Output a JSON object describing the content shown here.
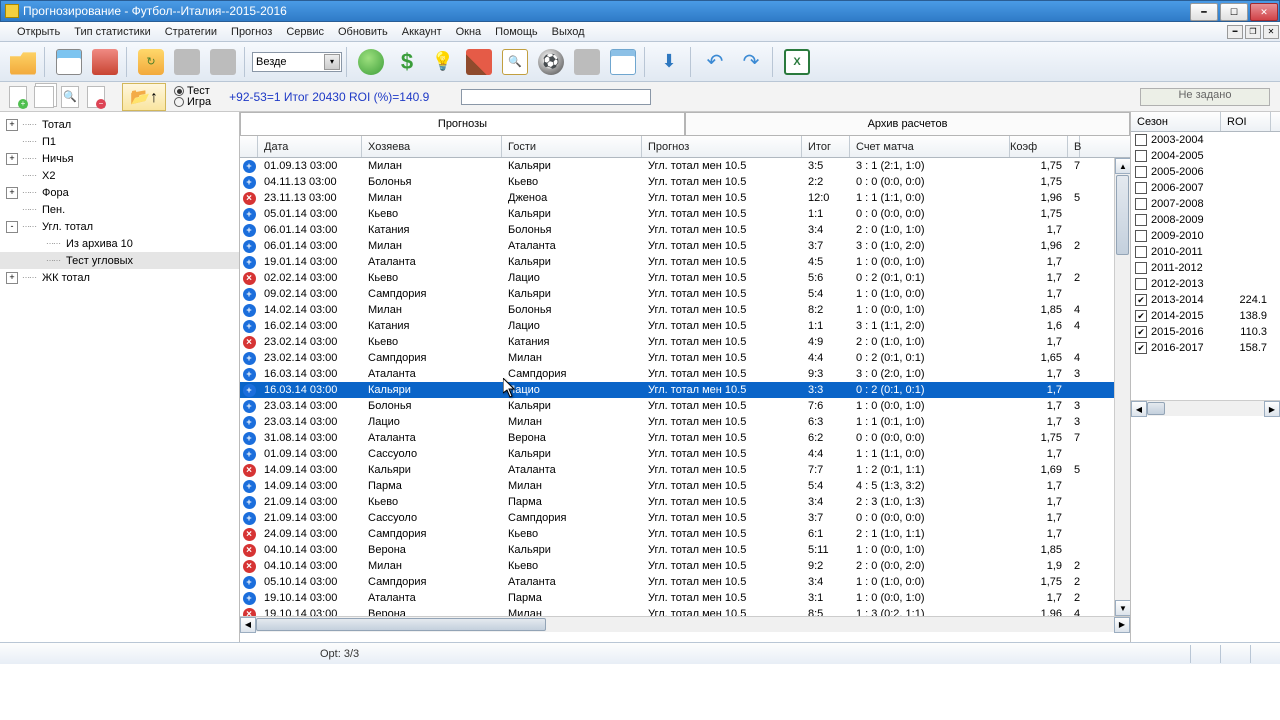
{
  "title": "Прогнозирование - Футбол--Италия--2015-2016",
  "menu": [
    "Открыть",
    "Тип статистики",
    "Стратегии",
    "Прогноз",
    "Сервис",
    "Обновить",
    "Аккаунт",
    "Окна",
    "Помощь",
    "Выход"
  ],
  "combo": "Везде",
  "radio": {
    "test": "Тест",
    "game": "Игра"
  },
  "summary": "+92-53=1 Итог 20430 ROI (%)=140.9",
  "unassigned": "Не задано",
  "tree": [
    {
      "label": "Тотал",
      "toggle": "+"
    },
    {
      "label": "П1",
      "none": true
    },
    {
      "label": "Ничья",
      "toggle": "+"
    },
    {
      "label": "X2",
      "none": true
    },
    {
      "label": "Фора",
      "toggle": "+"
    },
    {
      "label": "Пен.",
      "none": true
    },
    {
      "label": "Угл. тотал",
      "toggle": "-",
      "children": [
        {
          "label": "Из архива 10"
        },
        {
          "label": "Тест угловых",
          "selected": true
        }
      ]
    },
    {
      "label": "ЖК тотал",
      "toggle": "+"
    }
  ],
  "tabs": {
    "forecasts": "Прогнозы",
    "archive": "Архив расчетов"
  },
  "columns": [
    "Дата",
    "Хозяева",
    "Гости",
    "Прогноз",
    "Итог",
    "Счет матча",
    "Коэф",
    "В"
  ],
  "rows": [
    {
      "p": 1,
      "d": "01.09.13 03:00",
      "h": "Милан",
      "a": "Кальяри",
      "pr": "Угл. тотал мен 10.5",
      "i": "3:5",
      "s": "3 : 1 (2:1, 1:0)",
      "c": "1,75",
      "l": "7"
    },
    {
      "p": 1,
      "d": "04.11.13 03:00",
      "h": "Болонья",
      "a": "Кьево",
      "pr": "Угл. тотал мен 10.5",
      "i": "2:2",
      "s": "0 : 0 (0:0, 0:0)",
      "c": "1,75",
      "l": ""
    },
    {
      "p": 0,
      "d": "23.11.13 03:00",
      "h": "Милан",
      "a": "Дженоа",
      "pr": "Угл. тотал мен 10.5",
      "i": "12:0",
      "s": "1 : 1 (1:1, 0:0)",
      "c": "1,96",
      "l": "5"
    },
    {
      "p": 1,
      "d": "05.01.14 03:00",
      "h": "Кьево",
      "a": "Кальяри",
      "pr": "Угл. тотал мен 10.5",
      "i": "1:1",
      "s": "0 : 0 (0:0, 0:0)",
      "c": "1,75",
      "l": ""
    },
    {
      "p": 1,
      "d": "06.01.14 03:00",
      "h": "Катания",
      "a": "Болонья",
      "pr": "Угл. тотал мен 10.5",
      "i": "3:4",
      "s": "2 : 0 (1:0, 1:0)",
      "c": "1,7",
      "l": ""
    },
    {
      "p": 1,
      "d": "06.01.14 03:00",
      "h": "Милан",
      "a": "Аталанта",
      "pr": "Угл. тотал мен 10.5",
      "i": "3:7",
      "s": "3 : 0 (1:0, 2:0)",
      "c": "1,96",
      "l": "2"
    },
    {
      "p": 1,
      "d": "19.01.14 03:00",
      "h": "Аталанта",
      "a": "Кальяри",
      "pr": "Угл. тотал мен 10.5",
      "i": "4:5",
      "s": "1 : 0 (0:0, 1:0)",
      "c": "1,7",
      "l": ""
    },
    {
      "p": 0,
      "d": "02.02.14 03:00",
      "h": "Кьево",
      "a": "Лацио",
      "pr": "Угл. тотал мен 10.5",
      "i": "5:6",
      "s": "0 : 2 (0:1, 0:1)",
      "c": "1,7",
      "l": "2"
    },
    {
      "p": 1,
      "d": "09.02.14 03:00",
      "h": "Сампдория",
      "a": "Кальяри",
      "pr": "Угл. тотал мен 10.5",
      "i": "5:4",
      "s": "1 : 0 (1:0, 0:0)",
      "c": "1,7",
      "l": ""
    },
    {
      "p": 1,
      "d": "14.02.14 03:00",
      "h": "Милан",
      "a": "Болонья",
      "pr": "Угл. тотал мен 10.5",
      "i": "8:2",
      "s": "1 : 0 (0:0, 1:0)",
      "c": "1,85",
      "l": "4"
    },
    {
      "p": 1,
      "d": "16.02.14 03:00",
      "h": "Катания",
      "a": "Лацио",
      "pr": "Угл. тотал мен 10.5",
      "i": "1:1",
      "s": "3 : 1 (1:1, 2:0)",
      "c": "1,6",
      "l": "4"
    },
    {
      "p": 0,
      "d": "23.02.14 03:00",
      "h": "Кьево",
      "a": "Катания",
      "pr": "Угл. тотал мен 10.5",
      "i": "4:9",
      "s": "2 : 0 (1:0, 1:0)",
      "c": "1,7",
      "l": ""
    },
    {
      "p": 1,
      "d": "23.02.14 03:00",
      "h": "Сампдория",
      "a": "Милан",
      "pr": "Угл. тотал мен 10.5",
      "i": "4:4",
      "s": "0 : 2 (0:1, 0:1)",
      "c": "1,65",
      "l": "4"
    },
    {
      "p": 1,
      "d": "16.03.14 03:00",
      "h": "Аталанта",
      "a": "Сампдория",
      "pr": "Угл. тотал мен 10.5",
      "i": "9:3",
      "s": "3 : 0 (2:0, 1:0)",
      "c": "1,7",
      "l": "3"
    },
    {
      "p": 1,
      "d": "16.03.14 03:00",
      "h": "Кальяри",
      "a": "Лацио",
      "pr": "Угл. тотал мен 10.5",
      "i": "3:3",
      "s": "0 : 2 (0:1, 0:1)",
      "c": "1,7",
      "l": "",
      "sel": true
    },
    {
      "p": 1,
      "d": "23.03.14 03:00",
      "h": "Болонья",
      "a": "Кальяри",
      "pr": "Угл. тотал мен 10.5",
      "i": "7:6",
      "s": "1 : 0 (0:0, 1:0)",
      "c": "1,7",
      "l": "3"
    },
    {
      "p": 1,
      "d": "23.03.14 03:00",
      "h": "Лацио",
      "a": "Милан",
      "pr": "Угл. тотал мен 10.5",
      "i": "6:3",
      "s": "1 : 1 (0:1, 1:0)",
      "c": "1,7",
      "l": "3"
    },
    {
      "p": 1,
      "d": "31.08.14 03:00",
      "h": "Аталанта",
      "a": "Верона",
      "pr": "Угл. тотал мен 10.5",
      "i": "6:2",
      "s": "0 : 0 (0:0, 0:0)",
      "c": "1,75",
      "l": "7"
    },
    {
      "p": 1,
      "d": "01.09.14 03:00",
      "h": "Сассуоло",
      "a": "Кальяри",
      "pr": "Угл. тотал мен 10.5",
      "i": "4:4",
      "s": "1 : 1 (1:1, 0:0)",
      "c": "1,7",
      "l": ""
    },
    {
      "p": 0,
      "d": "14.09.14 03:00",
      "h": "Кальяри",
      "a": "Аталанта",
      "pr": "Угл. тотал мен 10.5",
      "i": "7:7",
      "s": "1 : 2 (0:1, 1:1)",
      "c": "1,69",
      "l": "5"
    },
    {
      "p": 1,
      "d": "14.09.14 03:00",
      "h": "Парма",
      "a": "Милан",
      "pr": "Угл. тотал мен 10.5",
      "i": "5:4",
      "s": "4 : 5 (1:3, 3:2)",
      "c": "1,7",
      "l": ""
    },
    {
      "p": 1,
      "d": "21.09.14 03:00",
      "h": "Кьево",
      "a": "Парма",
      "pr": "Угл. тотал мен 10.5",
      "i": "3:4",
      "s": "2 : 3 (1:0, 1:3)",
      "c": "1,7",
      "l": ""
    },
    {
      "p": 1,
      "d": "21.09.14 03:00",
      "h": "Сассуоло",
      "a": "Сампдория",
      "pr": "Угл. тотал мен 10.5",
      "i": "3:7",
      "s": "0 : 0 (0:0, 0:0)",
      "c": "1,7",
      "l": ""
    },
    {
      "p": 0,
      "d": "24.09.14 03:00",
      "h": "Сампдория",
      "a": "Кьево",
      "pr": "Угл. тотал мен 10.5",
      "i": "6:1",
      "s": "2 : 1 (1:0, 1:1)",
      "c": "1,7",
      "l": ""
    },
    {
      "p": 0,
      "d": "04.10.14 03:00",
      "h": "Верона",
      "a": "Кальяри",
      "pr": "Угл. тотал мен 10.5",
      "i": "5:11",
      "s": "1 : 0 (0:0, 1:0)",
      "c": "1,85",
      "l": ""
    },
    {
      "p": 0,
      "d": "04.10.14 03:00",
      "h": "Милан",
      "a": "Кьево",
      "pr": "Угл. тотал мен 10.5",
      "i": "9:2",
      "s": "2 : 0 (0:0, 2:0)",
      "c": "1,9",
      "l": "2"
    },
    {
      "p": 1,
      "d": "05.10.14 03:00",
      "h": "Сампдория",
      "a": "Аталанта",
      "pr": "Угл. тотал мен 10.5",
      "i": "3:4",
      "s": "1 : 0 (1:0, 0:0)",
      "c": "1,75",
      "l": "2"
    },
    {
      "p": 1,
      "d": "19.10.14 03:00",
      "h": "Аталанта",
      "a": "Парма",
      "pr": "Угл. тотал мен 10.5",
      "i": "3:1",
      "s": "1 : 0 (0:0, 1:0)",
      "c": "1,7",
      "l": "2"
    },
    {
      "p": 0,
      "d": "19.10.14 03:00",
      "h": "Верона",
      "a": "Милан",
      "pr": "Угл. тотал мен 10.5",
      "i": "8:5",
      "s": "1 : 3 (0:2, 1:1)",
      "c": "1,96",
      "l": "4"
    }
  ],
  "season_columns": [
    "Сезон",
    "ROI"
  ],
  "seasons": [
    {
      "s": "2003-2004",
      "r": "",
      "c": false
    },
    {
      "s": "2004-2005",
      "r": "",
      "c": false
    },
    {
      "s": "2005-2006",
      "r": "",
      "c": false
    },
    {
      "s": "2006-2007",
      "r": "",
      "c": false
    },
    {
      "s": "2007-2008",
      "r": "",
      "c": false
    },
    {
      "s": "2008-2009",
      "r": "",
      "c": false
    },
    {
      "s": "2009-2010",
      "r": "",
      "c": false
    },
    {
      "s": "2010-2011",
      "r": "",
      "c": false
    },
    {
      "s": "2011-2012",
      "r": "",
      "c": false
    },
    {
      "s": "2012-2013",
      "r": "",
      "c": false
    },
    {
      "s": "2013-2014",
      "r": "224.1",
      "c": true
    },
    {
      "s": "2014-2015",
      "r": "138.9",
      "c": true
    },
    {
      "s": "2015-2016",
      "r": "110.3",
      "c": true
    },
    {
      "s": "2016-2017",
      "r": "158.7",
      "c": true
    }
  ],
  "status": "Opt: 3/3"
}
